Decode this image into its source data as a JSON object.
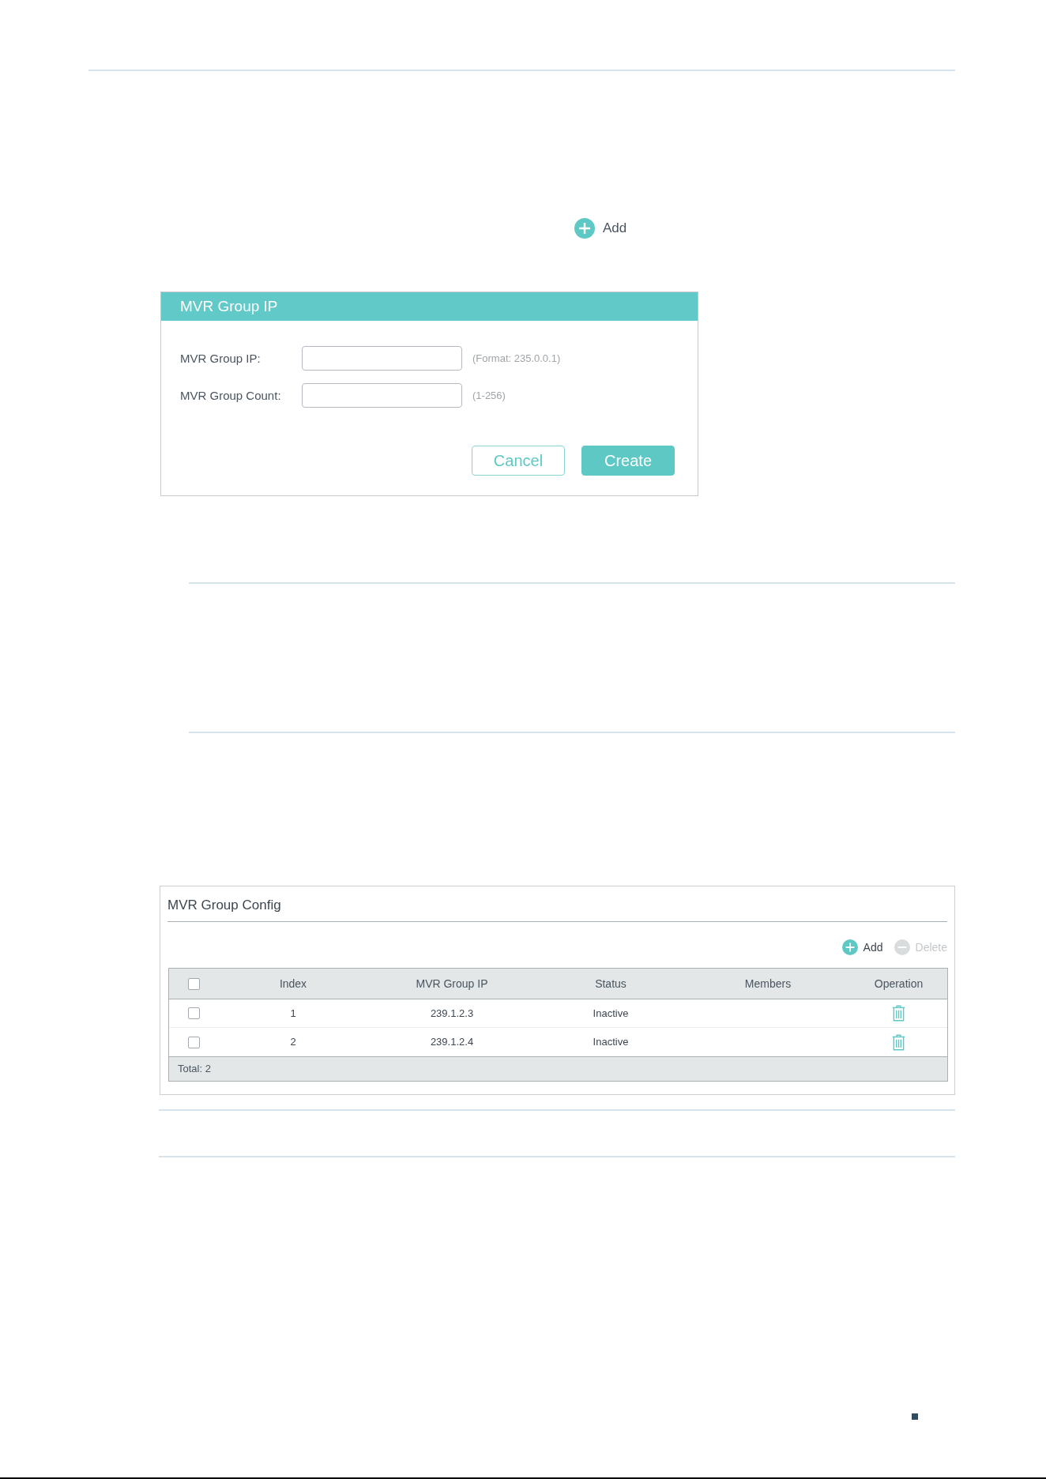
{
  "top_add": {
    "label": "Add"
  },
  "dialog": {
    "title": "MVR Group IP",
    "fields": [
      {
        "label": "MVR Group IP:",
        "note": "(Format: 235.0.0.1)"
      },
      {
        "label": "MVR Group Count:",
        "note": "(1-256)"
      }
    ],
    "buttons": [
      {
        "label": "Cancel",
        "kind": "secondary"
      },
      {
        "label": "Create",
        "kind": "primary"
      }
    ]
  },
  "config_panel": {
    "title": "MVR Group Config",
    "actions": [
      {
        "label": "Add",
        "kind": "add",
        "disabled": false
      },
      {
        "label": "Delete",
        "kind": "delete",
        "disabled": true
      }
    ],
    "table": {
      "header_checked": false,
      "columns": [
        "Index",
        "MVR Group IP",
        "Status",
        "Members",
        "Operation"
      ],
      "rows": [
        {
          "checked": false,
          "index": "1",
          "ip": "239.1.2.3",
          "status": "Inactive"
        },
        {
          "checked": false,
          "index": "2",
          "ip": "239.1.2.4",
          "status": "Inactive"
        }
      ],
      "footer": "Total: 2"
    }
  }
}
